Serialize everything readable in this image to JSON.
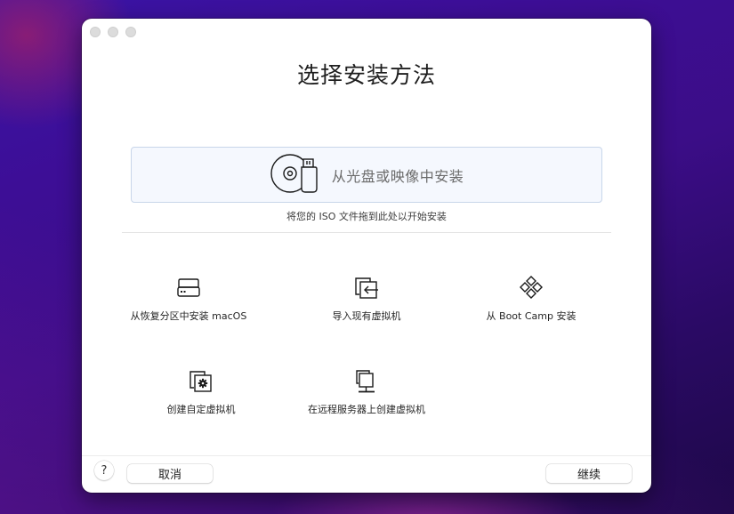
{
  "window": {
    "title": "选择安装方法",
    "traffic_lights": [
      "close",
      "minimize",
      "zoom"
    ]
  },
  "drop_zone": {
    "label": "从光盘或映像中安装",
    "icon": "disc-usb-icon",
    "hint": "将您的 ISO 文件拖到此处以开始安装"
  },
  "options": [
    {
      "id": "recovery",
      "label": "从恢复分区中安装 macOS",
      "icon": "drive-icon"
    },
    {
      "id": "import",
      "label": "导入现有虚拟机",
      "icon": "import-icon"
    },
    {
      "id": "bootcamp",
      "label": "从 Boot Camp 安装",
      "icon": "bootcamp-icon"
    },
    {
      "id": "custom",
      "label": "创建自定虚拟机",
      "icon": "custom-vm-icon"
    },
    {
      "id": "remote",
      "label": "在远程服务器上创建虚拟机",
      "icon": "remote-server-icon"
    }
  ],
  "footer": {
    "help_label": "?",
    "cancel_label": "取消",
    "continue_label": "继续"
  }
}
